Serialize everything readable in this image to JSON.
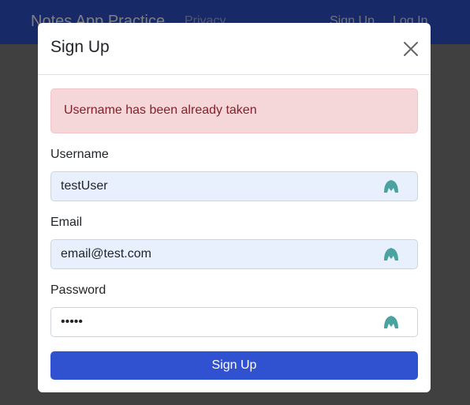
{
  "navbar": {
    "brand": "Notes App Practice",
    "links": [
      "Privacy",
      "Sign Up",
      "Log In"
    ]
  },
  "modal": {
    "title": "Sign Up",
    "close_icon": "close-icon",
    "alert": "Username has been already taken",
    "username": {
      "label": "Username",
      "value": "testUser"
    },
    "email": {
      "label": "Email",
      "value": "email@test.com"
    },
    "password": {
      "label": "Password",
      "value": "•••••"
    },
    "submit_label": "Sign Up",
    "field_icon": "password-manager-icon"
  },
  "colors": {
    "primary": "#3152d0",
    "alert_bg": "#f5d7da",
    "alert_text": "#842029",
    "autofill_bg": "#e8f0fe",
    "icon_teal": "#4aa3a0"
  }
}
